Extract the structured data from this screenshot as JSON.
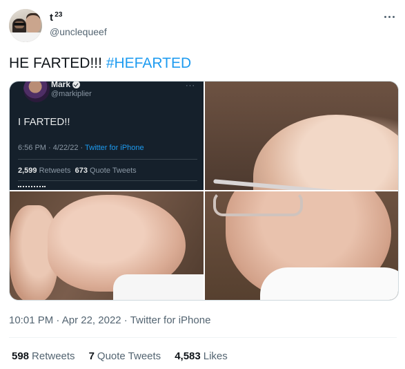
{
  "author": {
    "display_name": "t",
    "name_sup": "23",
    "handle": "@unclequeef"
  },
  "tweet": {
    "text": "HE FARTED!!! ",
    "hashtag": "#HEFARTED"
  },
  "embedded_tweet": {
    "name": "Mark",
    "handle": "@markiplier",
    "more": "···",
    "text": "I FARTED!!",
    "time": "6:56 PM · 4/22/22 · ",
    "source": "Twitter for iPhone",
    "retweets_count": "2,599",
    "retweets_label": "Retweets",
    "quote_count": "673",
    "quote_label": "Quote Tweets"
  },
  "meta": {
    "time": "10:01 PM",
    "sep1": " · ",
    "date": "Apr 22, 2022",
    "sep2": " · ",
    "source": "Twitter for iPhone"
  },
  "stats": {
    "retweets_count": "598",
    "retweets_label": "Retweets",
    "quotes_count": "7",
    "quotes_label": "Quote Tweets",
    "likes_count": "4,583",
    "likes_label": "Likes"
  },
  "colors": {
    "link": "#1d9bf0",
    "text": "#0f1419",
    "secondary": "#536471"
  }
}
